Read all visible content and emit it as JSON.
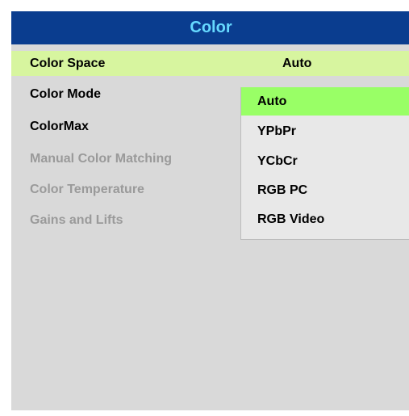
{
  "window": {
    "title": "Color"
  },
  "menu": {
    "items": [
      {
        "label": "Color Space",
        "value": "Auto"
      },
      {
        "label": "Color Mode"
      },
      {
        "label": "ColorMax"
      },
      {
        "label": "Manual Color Matching"
      },
      {
        "label": "Color Temperature"
      },
      {
        "label": "Gains and Lifts"
      }
    ]
  },
  "dropdown": {
    "selected": "Auto",
    "options": [
      "Auto",
      "YPbPr",
      "YCbCr",
      "RGB PC",
      "RGB Video"
    ]
  },
  "colors": {
    "title_bg": "#0a3d8f",
    "title_text": "#66d9ff",
    "selected_row": "#d7f59f",
    "highlight_option": "#99ff66",
    "panel_bg": "#d9d9d9",
    "disabled_text": "#9a9a9a"
  }
}
